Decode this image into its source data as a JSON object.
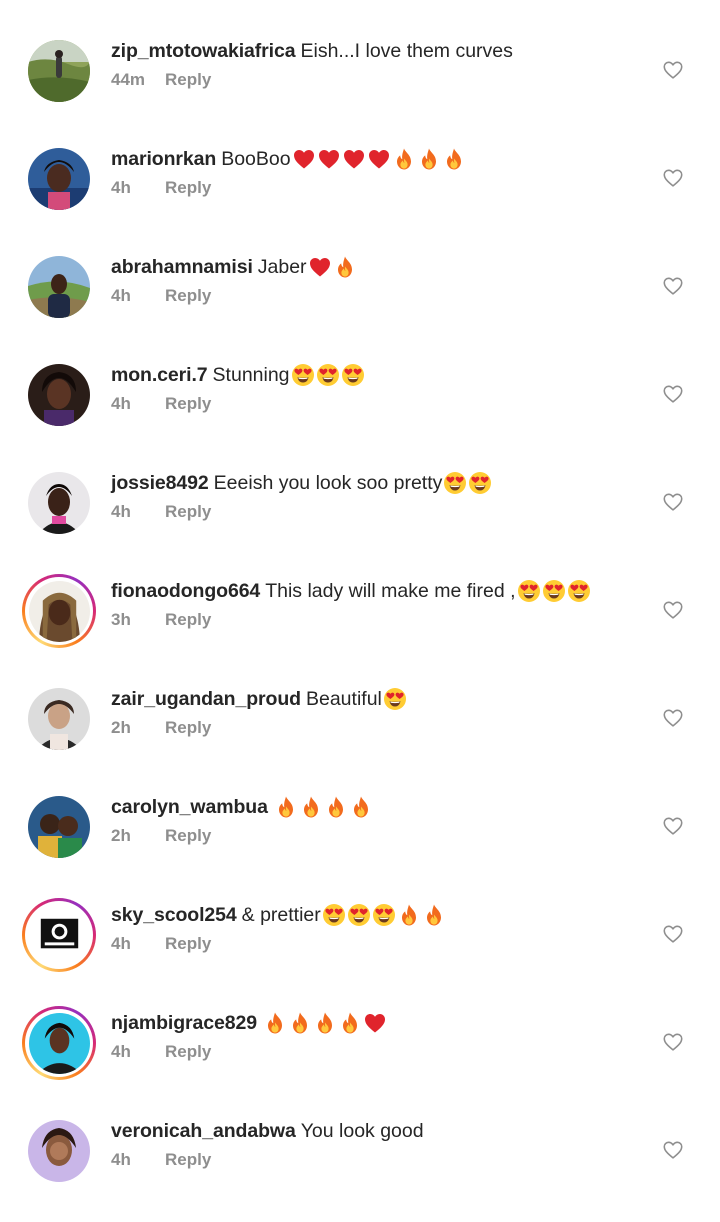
{
  "comments": [
    {
      "username": "zip_mtotowakiafrica",
      "text": "Eish...I love them curves",
      "emojis": [],
      "time": "44m",
      "reply": "Reply",
      "story": false,
      "avatar": "landscape"
    },
    {
      "username": "marionrkan",
      "text": "BooBoo",
      "emojis": [
        "heart",
        "heart",
        "heart",
        "heart",
        "fire",
        "fire",
        "fire"
      ],
      "time": "4h",
      "reply": "Reply",
      "story": false,
      "avatar": "blue-portrait"
    },
    {
      "username": "abrahamnamisi",
      "text": "Jaber",
      "emojis": [
        "heart",
        "fire"
      ],
      "time": "4h",
      "reply": "Reply",
      "story": false,
      "avatar": "outdoor"
    },
    {
      "username": "mon.ceri.7",
      "text": "Stunning",
      "emojis": [
        "heart-eyes",
        "heart-eyes",
        "heart-eyes"
      ],
      "time": "4h",
      "reply": "Reply",
      "story": false,
      "avatar": "dark-portrait"
    },
    {
      "username": "jossie8492",
      "text": "Eeeish you look soo pretty ",
      "emojis": [
        "heart-eyes",
        "heart-eyes"
      ],
      "time": "4h",
      "reply": "Reply",
      "story": false,
      "avatar": "light-portrait"
    },
    {
      "username": "fionaodongo664",
      "text": "This lady will make me fired ,",
      "emojis": [
        "heart-eyes",
        "heart-eyes",
        "heart-eyes"
      ],
      "time": "3h",
      "reply": "Reply",
      "story": true,
      "avatar": "braids"
    },
    {
      "username": "zair_ugandan_proud",
      "text": "Beautiful ",
      "emojis": [
        "heart-eyes"
      ],
      "time": "2h",
      "reply": "Reply",
      "story": false,
      "avatar": "gray-portrait"
    },
    {
      "username": "carolyn_wambua",
      "text": "",
      "emojis": [
        "fire",
        "fire",
        "fire",
        "fire"
      ],
      "time": "2h",
      "reply": "Reply",
      "story": false,
      "avatar": "couple"
    },
    {
      "username": "sky_scool254",
      "text": "& prettier",
      "emojis": [
        "heart-eyes",
        "heart-eyes",
        "heart-eyes",
        "fire",
        "fire"
      ],
      "time": "4h",
      "reply": "Reply",
      "story": true,
      "avatar": "logo"
    },
    {
      "username": "njambigrace829",
      "text": "",
      "emojis": [
        "fire",
        "fire",
        "fire",
        "fire",
        "heart"
      ],
      "time": "4h",
      "reply": "Reply",
      "story": true,
      "avatar": "cyan-portrait"
    },
    {
      "username": "veronicah_andabwa",
      "text": "You look good",
      "emojis": [],
      "time": "4h",
      "reply": "Reply",
      "story": false,
      "avatar": "purple-portrait"
    }
  ],
  "colors": {
    "text": "#262626",
    "meta": "#8e8e8e",
    "heart_emoji": "#e0242c",
    "fire_outer": "#f26b1d",
    "fire_inner": "#ffc83d",
    "face_yellow": "#ffcc33",
    "heart_outline": "#8e8e8e"
  },
  "icons": {
    "like": "heart-outline-icon"
  }
}
